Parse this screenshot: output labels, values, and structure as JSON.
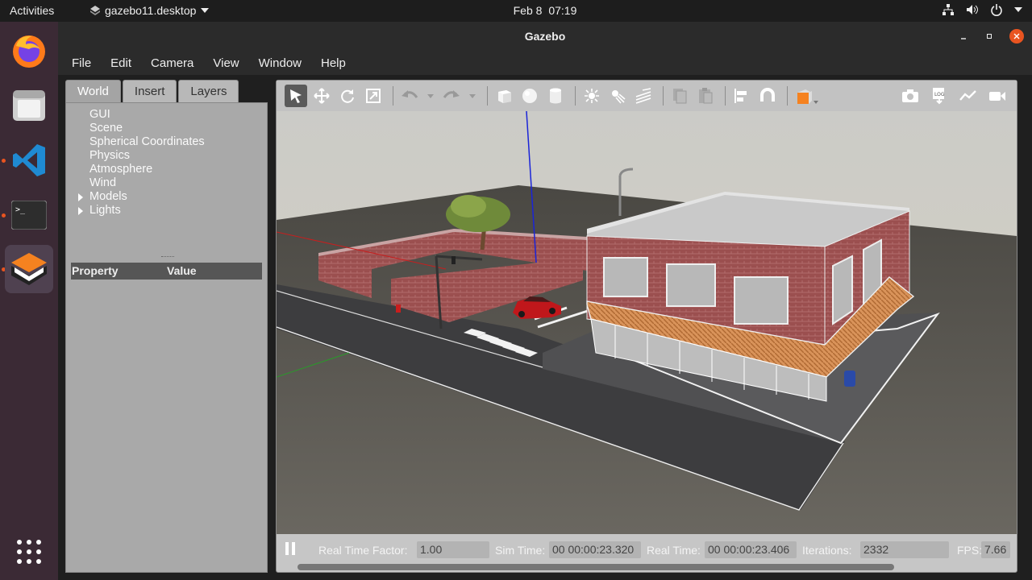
{
  "topbar": {
    "activities": "Activities",
    "app_menu": "gazebo11.desktop",
    "date": "Feb 8",
    "time": "07:19"
  },
  "window": {
    "title": "Gazebo"
  },
  "menu": [
    "File",
    "Edit",
    "Camera",
    "View",
    "Window",
    "Help"
  ],
  "left_panel": {
    "tabs": [
      "World",
      "Insert",
      "Layers"
    ],
    "active_tab": "World",
    "tree": [
      {
        "label": "GUI",
        "expandable": false
      },
      {
        "label": "Scene",
        "expandable": false
      },
      {
        "label": "Spherical Coordinates",
        "expandable": false
      },
      {
        "label": "Physics",
        "expandable": false
      },
      {
        "label": "Atmosphere",
        "expandable": false
      },
      {
        "label": "Wind",
        "expandable": false
      },
      {
        "label": "Models",
        "expandable": true
      },
      {
        "label": "Lights",
        "expandable": true
      }
    ],
    "property_header": "Property",
    "value_header": "Value"
  },
  "status": {
    "real_time_factor_label": "Real Time Factor:",
    "real_time_factor": "1.00",
    "sim_time_label": "Sim Time:",
    "sim_time": "00 00:00:23.320",
    "real_time_label": "Real Time:",
    "real_time": "00 00:00:23.406",
    "iterations_label": "Iterations:",
    "iterations": "2332",
    "fps_label": "FPS:",
    "fps": "7.66"
  },
  "colors": {
    "accent": "#e95420",
    "dock": "#3b2a35",
    "titlebar": "#2b2b2b"
  }
}
